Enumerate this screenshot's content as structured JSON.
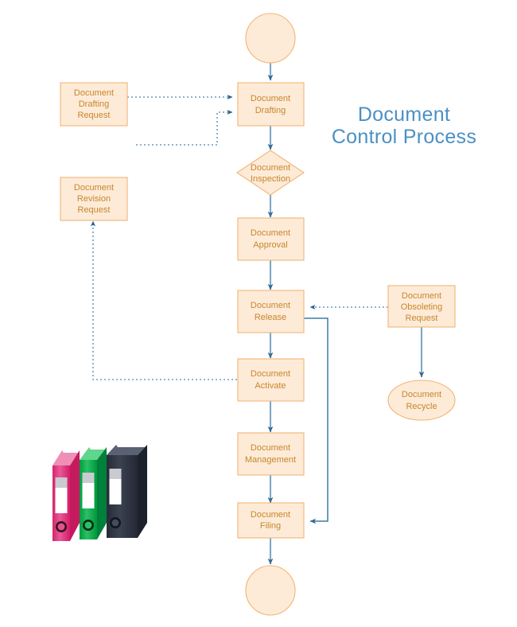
{
  "title": {
    "line1": "Document",
    "line2": "Control Process"
  },
  "colors": {
    "shape_fill": "#FDEBD8",
    "shape_border": "#F3B475",
    "node_text": "#C8862A",
    "title_text": "#4A90C4",
    "connector_solid": "#7FA8C4",
    "connector_return": "#3B7CA5",
    "connector_dotted": "#4E86B8",
    "binder_pink": "#E8417E",
    "binder_green": "#0FA84A",
    "binder_navy": "#2E3342",
    "background": "#FFFFFF"
  },
  "nodes": {
    "start": {
      "label": "",
      "shape": "circle"
    },
    "drafting_request": {
      "line1": "Document",
      "line2": "Drafting",
      "line3": "Request",
      "shape": "process"
    },
    "drafting": {
      "line1": "Document",
      "line2": "Drafting",
      "shape": "process"
    },
    "inspection": {
      "line1": "Document",
      "line2": "Inspection",
      "shape": "decision"
    },
    "revision_request": {
      "line1": "Document",
      "line2": "Revision",
      "line3": "Request",
      "shape": "process"
    },
    "approval": {
      "line1": "Document",
      "line2": "Approval",
      "shape": "process"
    },
    "release": {
      "line1": "Document",
      "line2": "Release",
      "shape": "process"
    },
    "obsoleting_request": {
      "line1": "Document",
      "line2": "Obsoleting",
      "line3": "Request",
      "shape": "process"
    },
    "recycle": {
      "line1": "Document",
      "line2": "Recycle",
      "shape": "ellipse"
    },
    "activate": {
      "line1": "Document",
      "line2": "Activate",
      "shape": "process"
    },
    "management": {
      "line1": "Document",
      "line2": "Management",
      "shape": "process"
    },
    "filing": {
      "line1": "Document",
      "line2": "Filing",
      "shape": "process"
    },
    "end": {
      "label": "",
      "shape": "circle"
    }
  },
  "binders": {
    "count": 3,
    "items": [
      {
        "name": "binder-pink",
        "color": "#E8417E"
      },
      {
        "name": "binder-green",
        "color": "#0FA84A"
      },
      {
        "name": "binder-navy",
        "color": "#2E3342"
      }
    ]
  }
}
